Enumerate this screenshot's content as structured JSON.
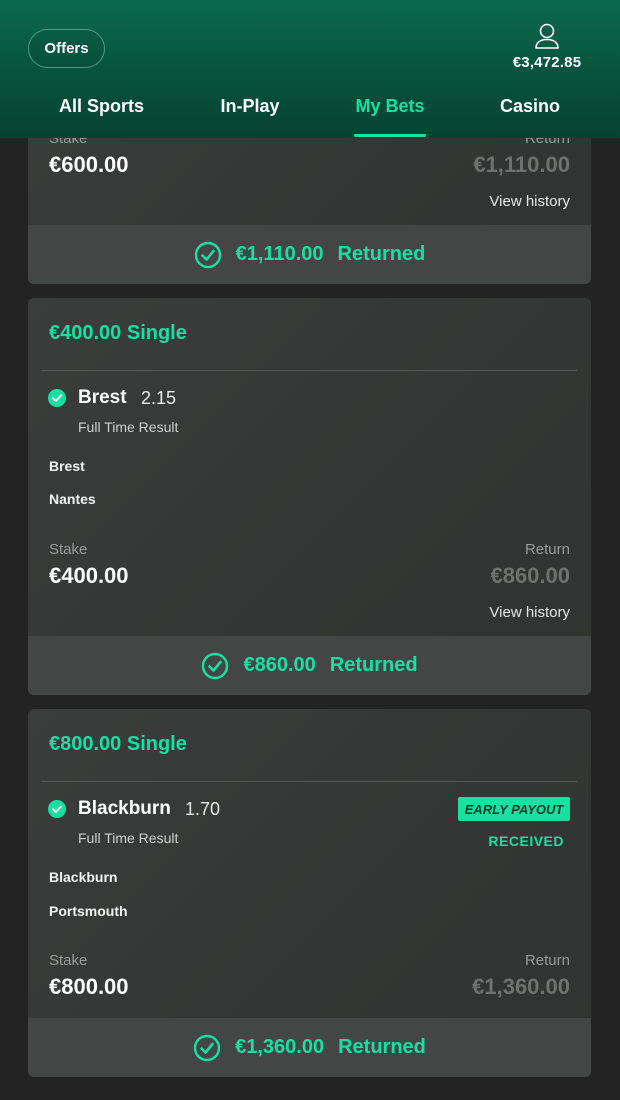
{
  "header": {
    "offers_label": "Offers",
    "balance": "€3,472.85",
    "account_icon": "user-icon",
    "tabs": [
      {
        "label": "All Sports"
      },
      {
        "label": "In-Play"
      },
      {
        "label": "My Bets"
      },
      {
        "label": "Casino"
      }
    ],
    "active_tab": "My Bets"
  },
  "colors": {
    "accent": "#17e0a0",
    "header_green": "#07523b",
    "card_bg": "#363837",
    "footer_bg": "#444645"
  },
  "bets": [
    {
      "stake_label": "Stake",
      "stake": "€600.00",
      "return_label": "Return",
      "return": "€1,110.00",
      "view_history": "View history",
      "footer_amount": "€1,110.00",
      "footer_status": "Returned"
    },
    {
      "title": "€400.00 Single",
      "selection": "Brest",
      "odds": "2.15",
      "market": "Full Time Result",
      "home_team": "Brest",
      "away_team": "Nantes",
      "stake_label": "Stake",
      "stake": "€400.00",
      "return_label": "Return",
      "return": "€860.00",
      "view_history": "View history",
      "footer_amount": "€860.00",
      "footer_status": "Returned"
    },
    {
      "title": "€800.00 Single",
      "selection": "Blackburn",
      "odds": "1.70",
      "market": "Full Time Result",
      "badge": "EARLY PAYOUT",
      "badge_status": "RECEIVED",
      "home_team": "Blackburn",
      "away_team": "Portsmouth",
      "stake_label": "Stake",
      "stake": "€800.00",
      "return_label": "Return",
      "return": "€1,360.00",
      "footer_amount": "€1,360.00",
      "footer_status": "Returned"
    }
  ]
}
